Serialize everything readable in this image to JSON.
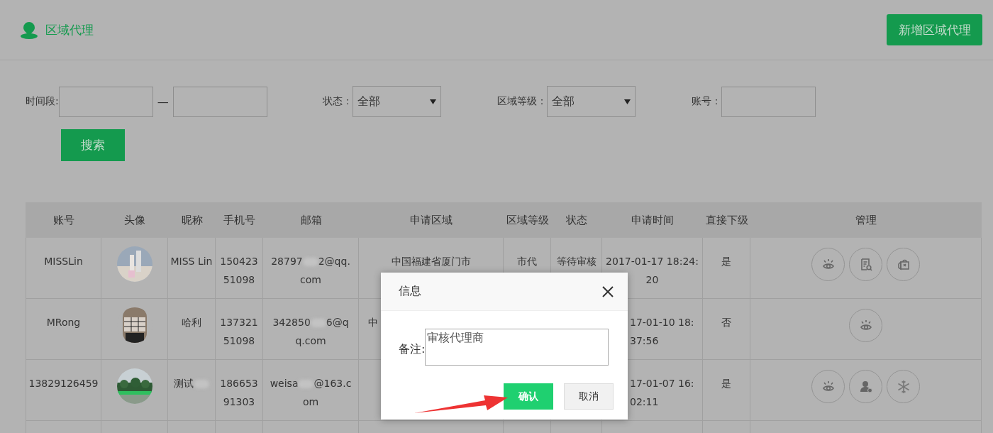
{
  "page": {
    "title": "区域代理",
    "add_button": "新增区域代理"
  },
  "filters": {
    "period_label": "时间段:",
    "separator": "—",
    "status_label": "状态：",
    "status_value": "全部",
    "level_label": "区域等级：",
    "level_value": "全部",
    "account_label": "账号：",
    "search_button": "搜索"
  },
  "table": {
    "columns": [
      "账号",
      "头像",
      "昵称",
      "手机号",
      "邮箱",
      "申请区域",
      "区域等级",
      "状态",
      "申请时间",
      "直接下级",
      "管理"
    ],
    "rows": [
      {
        "account": "MISSLin",
        "nickname": "MISS Lin",
        "nickname_blurred": false,
        "phone": "15042351098",
        "email": [
          "28797",
          "2@qq.com"
        ],
        "region": "中国福建省厦门市",
        "covered": false,
        "level": "市代",
        "status": "等待审核",
        "time": "2017-01-17 18:24:20",
        "direct": "是",
        "actions": [
          {
            "kind": "view"
          },
          {
            "kind": "review"
          },
          {
            "kind": "bag"
          }
        ]
      },
      {
        "account": "MRong",
        "nickname": "哈利",
        "nickname_blurred": false,
        "phone": "13732151098",
        "email": [
          "342850",
          "6@qq.com"
        ],
        "region": "中",
        "covered": true,
        "time": "17-01-10 18:37:56",
        "direct": "否",
        "actions": [
          {
            "kind": "view"
          }
        ]
      },
      {
        "account": "13829126459",
        "nickname": "测试",
        "nickname_blurred": true,
        "phone": "18665391303",
        "email": [
          "weisa",
          "@163.com"
        ],
        "covered": true,
        "time": "17-01-07 16:02:11",
        "direct": "是",
        "actions": [
          {
            "kind": "view"
          },
          {
            "kind": "user"
          },
          {
            "kind": "freeze"
          }
        ]
      }
    ]
  },
  "dialog": {
    "title": "信息",
    "note_label": "备注:",
    "note_value": "审核代理商",
    "confirm": "确认",
    "cancel": "取消"
  }
}
